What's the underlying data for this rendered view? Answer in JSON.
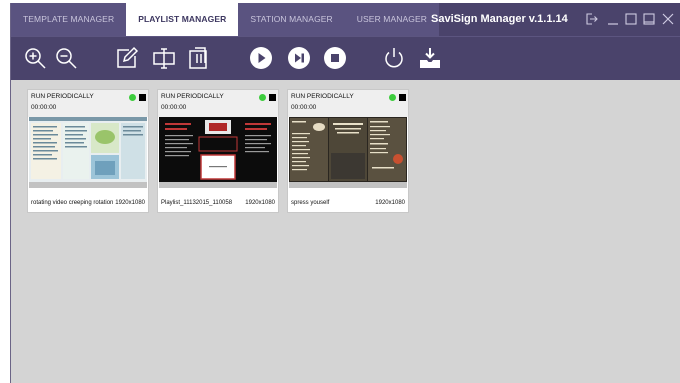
{
  "tabs": [
    {
      "label": "TEMPLATE MANAGER",
      "active": false
    },
    {
      "label": "PLAYLIST MANAGER",
      "active": true
    },
    {
      "label": "STATION MANAGER",
      "active": false
    },
    {
      "label": "USER MANAGER",
      "active": false
    }
  ],
  "app_title": "SaviSign Manager v.1.1.14",
  "window_controls": [
    "logout-icon",
    "minimize-icon",
    "maximize-icon",
    "restore-icon",
    "close-icon"
  ],
  "toolbar": [
    "zoom-in-icon",
    "zoom-out-icon",
    "edit-icon",
    "rename-icon",
    "delete-icon",
    "play-icon",
    "skip-icon",
    "stop-icon",
    "power-icon",
    "deploy-icon"
  ],
  "colors": {
    "chrome": "#4a436b",
    "active_tab": "#ffffff",
    "content_bg": "#d4d4d4",
    "status_green": "#3ccc3c"
  },
  "playlists": [
    {
      "mode": "RUN PERIODICALLY",
      "time": "00:00:00",
      "name": "rotating video creeping rotation",
      "resolution": "1920x1080"
    },
    {
      "mode": "RUN PERIODICALLY",
      "time": "00:00:00",
      "name": "Playlist_11132015_110058",
      "resolution": "1920x1080"
    },
    {
      "mode": "RUN PERIODICALLY",
      "time": "00:00:00",
      "name": "spress youself",
      "resolution": "1920x1080"
    }
  ]
}
